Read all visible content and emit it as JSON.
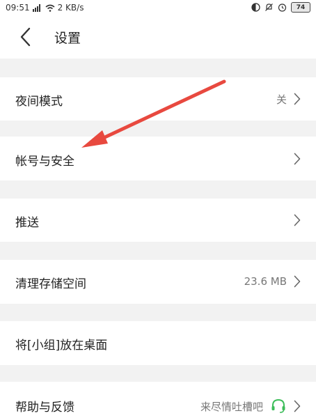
{
  "status_bar": {
    "time": "09:51",
    "signal": "↑↓▐",
    "net_speed": "2 KB/s",
    "battery": "74"
  },
  "header": {
    "title": "设置"
  },
  "settings": {
    "night_mode": {
      "label": "夜间模式",
      "value": "关"
    },
    "account_security": {
      "label": "帐号与安全"
    },
    "push": {
      "label": "推送"
    },
    "clear_storage": {
      "label": "清理存储空间",
      "value": "23.6 MB"
    },
    "pin_group": {
      "label": "将[小组]放在桌面"
    },
    "help_feedback": {
      "label": "帮助与反馈",
      "value": "来尽情吐槽吧"
    }
  },
  "colors": {
    "annotation_arrow": "#e8493f",
    "help_icon": "#3dbd5a",
    "section_gap": "#f2f2f2"
  }
}
